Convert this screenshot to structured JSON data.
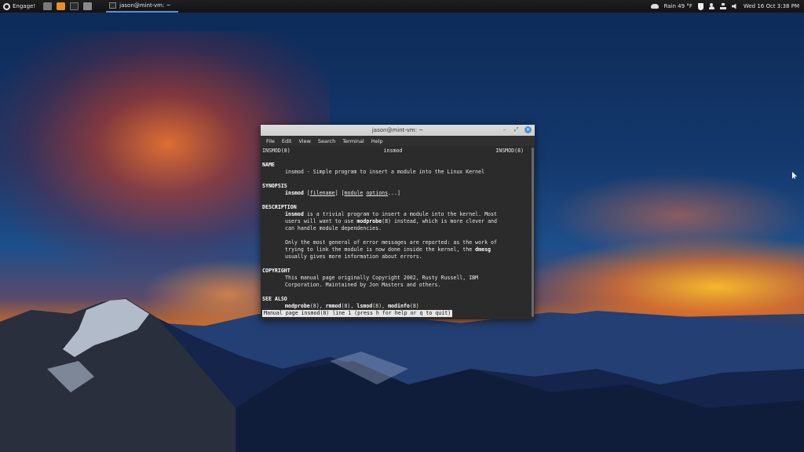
{
  "panel": {
    "menu_label": "Engage!",
    "launchers": [
      "files-icon",
      "firefox-icon",
      "terminal-icon",
      "folder-icon"
    ],
    "task_label": "jason@mint-vm: ~",
    "weather": "Rain 49 °F",
    "clock": "Wed 16 Oct  3:38 PM"
  },
  "window": {
    "title": "jason@mint-vm: ~",
    "menus": [
      "File",
      "Edit",
      "View",
      "Search",
      "Terminal",
      "Help"
    ]
  },
  "man": {
    "header_left": "INSMOD(8)",
    "header_center": "insmod",
    "header_right": "INSMOD(8)",
    "name_heading": "NAME",
    "name_line": "insmod - Simple program to insert a module into the Linux Kernel",
    "synopsis_heading": "SYNOPSIS",
    "syn_cmd": "insmod",
    "syn_open1": "[",
    "syn_arg1": "filename",
    "syn_close1": "]",
    "syn_open2": "[",
    "syn_arg2": "module",
    "syn_arg3": "options",
    "syn_close2": "...]",
    "description_heading": "DESCRIPTION",
    "d1_cmd": "insmod",
    "d1_rest": "is a trivial program to insert a module into the kernel. Most",
    "d2_pre": "users will want to use",
    "d2_cmd": "modprobe",
    "d2_rest": "(8) instead, which is more clever and",
    "d3": "can handle module dependencies.",
    "d4": "Only the most general of error messages are reported: as the work of",
    "d5_pre": "trying to link the module is now done inside the kernel, the",
    "d5_cmd": "dmesg",
    "d6": "usually gives more information about errors.",
    "copyright_heading": "COPYRIGHT",
    "c1": "This manual page originally Copyright 2002, Rusty Russell, IBM",
    "c2": "Corporation. Maintained by Jon Masters and others.",
    "see_also_heading": "SEE ALSO",
    "s_cmd1": "modprobe",
    "s_sec1": "(8), ",
    "s_cmd2": "rmmod",
    "s_sec2": "(8), ",
    "s_cmd3": "lsmod",
    "s_sec3": "(8), ",
    "s_cmd4": "modinfo",
    "s_sec4": "(8)",
    "status_line": "Manual page insmod(8) line 1 (press h for help or q to quit)"
  }
}
